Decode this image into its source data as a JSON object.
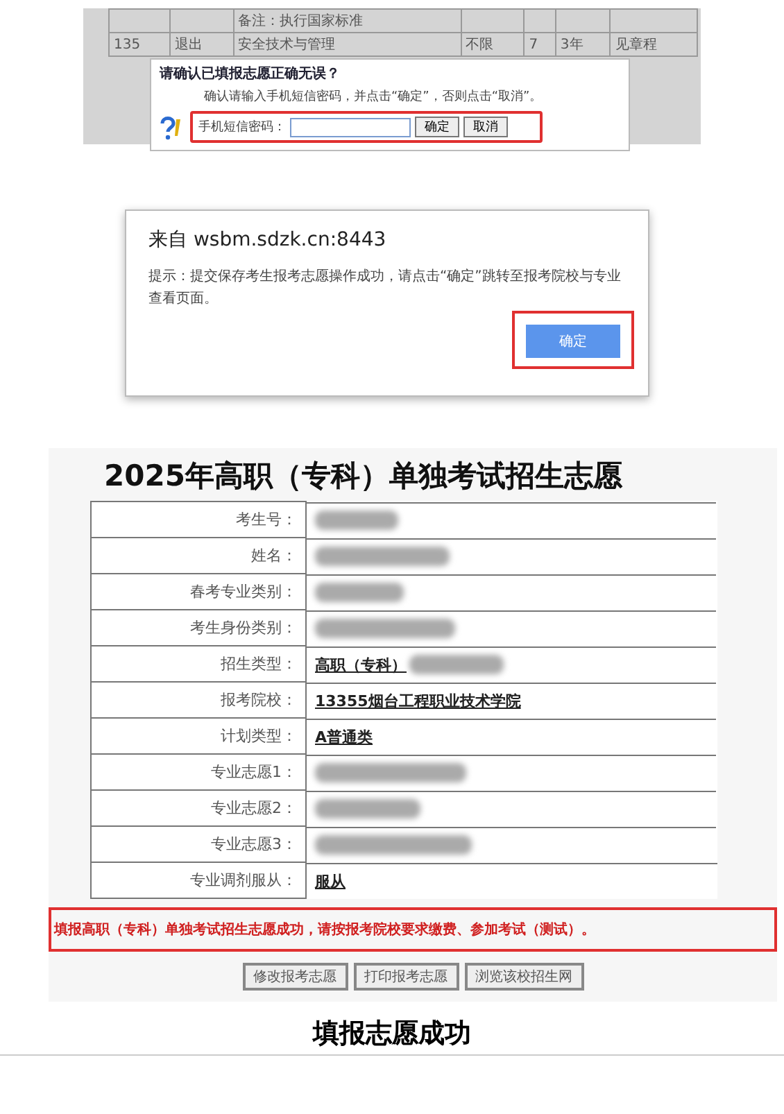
{
  "confirm_panel": {
    "background_rows": [
      {
        "cells": [
          "",
          "",
          "备注：执行国家标准",
          "",
          "",
          "",
          ""
        ]
      },
      {
        "cells": [
          "135",
          "退出",
          "安全技术与管理",
          "不限",
          "7",
          "3年",
          "见章程"
        ]
      }
    ],
    "dialog": {
      "title": "请确认已填报志愿正确无误？",
      "message": "确认请输入手机短信密码，并点击“确定”，否则点击“取消”。",
      "field_label": "手机短信密码：",
      "buttons": [
        "确定",
        "取消"
      ]
    }
  },
  "alert_panel": {
    "title": "来自 wsbm.sdzk.cn:8443",
    "message": "提示：提交保存考生报考志愿操作成功，请点击“确定”跳转至报考院校与专业查看页面。",
    "button": "确定"
  },
  "result_panel": {
    "title": "2025年高职（专科）单独考试招生志愿",
    "rows": [
      {
        "label": "考生号：",
        "redacted": true
      },
      {
        "label": "姓名：",
        "redacted": true
      },
      {
        "label": "春考专业类别：",
        "redacted": true
      },
      {
        "label": "考生身份类别：",
        "redacted": true
      },
      {
        "label": "招生类型：",
        "value": "高职（专科）",
        "redacted": true
      },
      {
        "label": "报考院校：",
        "value": "13355烟台工程职业技术学院",
        "redacted": false
      },
      {
        "label": "计划类型：",
        "value": "A普通类",
        "redacted": false
      },
      {
        "label": "专业志愿1：",
        "redacted": true
      },
      {
        "label": "专业志愿2：",
        "redacted": true
      },
      {
        "label": "专业志愿3：",
        "redacted": true
      },
      {
        "label": "专业调剂服从：",
        "value": "服从",
        "redacted": false
      }
    ],
    "notice": "填报高职（专科）单独考试招生志愿成功，请按报考院校要求缴费、参加考试（测试）。",
    "buttons": [
      "修改报考志愿",
      "打印报考志愿",
      "浏览该校招生网"
    ]
  },
  "caption": "填报志愿成功"
}
